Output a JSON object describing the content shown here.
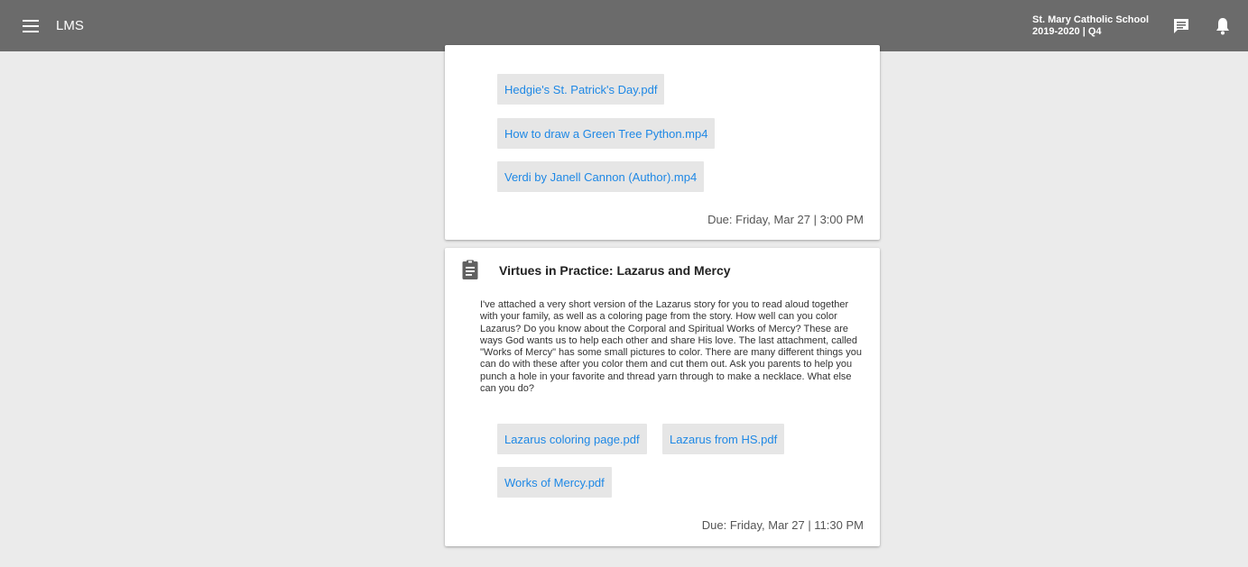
{
  "header": {
    "app_title": "LMS",
    "school_name": "St. Mary Catholic School",
    "term": "2019-2020 | Q4"
  },
  "icons": {
    "menu": "menu-icon",
    "messages": "chat-icon",
    "notifications": "bell-icon",
    "assignment": "clipboard-icon"
  },
  "colors": {
    "topbar": "#6b6b6b",
    "link": "#1e88e5",
    "attachment_bg": "#e6e6e6",
    "page_bg": "#ebebeb"
  },
  "assignments": [
    {
      "attachments": [
        "Hedgie's St. Patrick's Day.pdf",
        "How to draw a Green Tree Python.mp4",
        "Verdi by Janell Cannon (Author).mp4"
      ],
      "due": "Due: Friday, Mar 27 | 3:00 PM"
    },
    {
      "title": "Virtues in Practice: Lazarus and Mercy",
      "description": "I've attached a very short version of the Lazarus story for you to read aloud together with your family, as well as a coloring page from the story.  How well can you color Lazarus?  Do you know about the Corporal and Spiritual Works of Mercy?  These are ways God wants us to help each other and share His love.  The last attachment, called \"Works of Mercy\" has some small pictures to color.  There are many different things you can do with these after you color them and cut them out.  Ask you parents to help you punch a hole in your favorite and thread yarn through to make a necklace.  What else can you do?",
      "attachments": [
        "Lazarus coloring page.pdf",
        "Lazarus from HS.pdf",
        "Works of Mercy.pdf"
      ],
      "due": "Due: Friday, Mar 27 | 11:30 PM"
    }
  ]
}
